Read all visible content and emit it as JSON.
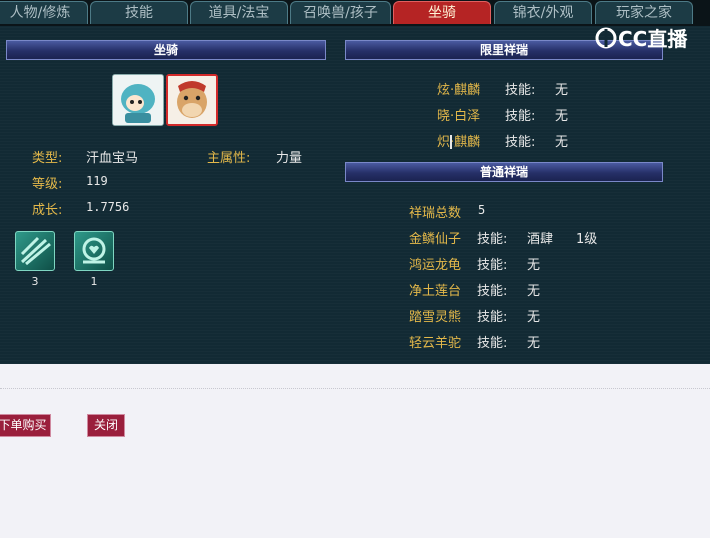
{
  "tabs": [
    {
      "label": "人物/修炼"
    },
    {
      "label": "技能"
    },
    {
      "label": "道具/法宝"
    },
    {
      "label": "召唤兽/孩子"
    },
    {
      "label": "坐骑"
    },
    {
      "label": "锦衣/外观"
    },
    {
      "label": "玩家之家"
    }
  ],
  "active_tab": "坐骑",
  "logo": {
    "text": "CC直播",
    "icon": "cc-live-logo-icon"
  },
  "mount": {
    "header": "坐骑",
    "type_label": "类型:",
    "type_value": "汗血宝马",
    "main_attr_label": "主属性:",
    "main_attr_value": "力量",
    "level_label": "等级:",
    "level_value": "119",
    "growth_label": "成长:",
    "growth_value": "1.7756",
    "skills": [
      {
        "icon": "mount-skill-rune-icon",
        "count": "3"
      },
      {
        "icon": "mount-skill-heart-icon",
        "count": "1"
      }
    ]
  },
  "limited": {
    "header": "限里祥瑞",
    "items": [
      {
        "name": "炫·麒麟",
        "skill_label": "技能:",
        "skill_value": "无"
      },
      {
        "name": "晓·白泽",
        "skill_label": "技能:",
        "skill_value": "无"
      },
      {
        "name": "炽·麒麟",
        "skill_label": "技能:",
        "skill_value": "无"
      }
    ]
  },
  "normal": {
    "header": "普通祥瑞",
    "total_label": "祥瑞总数",
    "total_value": "5",
    "items": [
      {
        "name": "金鳞仙子",
        "skill_label": "技能:",
        "skill_value": "酒肆",
        "level": "1级"
      },
      {
        "name": "鸿运龙龟",
        "skill_label": "技能:",
        "skill_value": "无"
      },
      {
        "name": "净土莲台",
        "skill_label": "技能:",
        "skill_value": "无"
      },
      {
        "name": "踏雪灵熊",
        "skill_label": "技能:",
        "skill_value": "无"
      },
      {
        "name": "轻云羊驼",
        "skill_label": "技能:",
        "skill_value": "无"
      }
    ]
  },
  "buttons": {
    "buy": "下单购买",
    "close": "关闭"
  },
  "colors": {
    "label": "#e3b84a",
    "panel": "#122a34",
    "active_tab": "#b52424",
    "button": "#9a1f3c"
  }
}
